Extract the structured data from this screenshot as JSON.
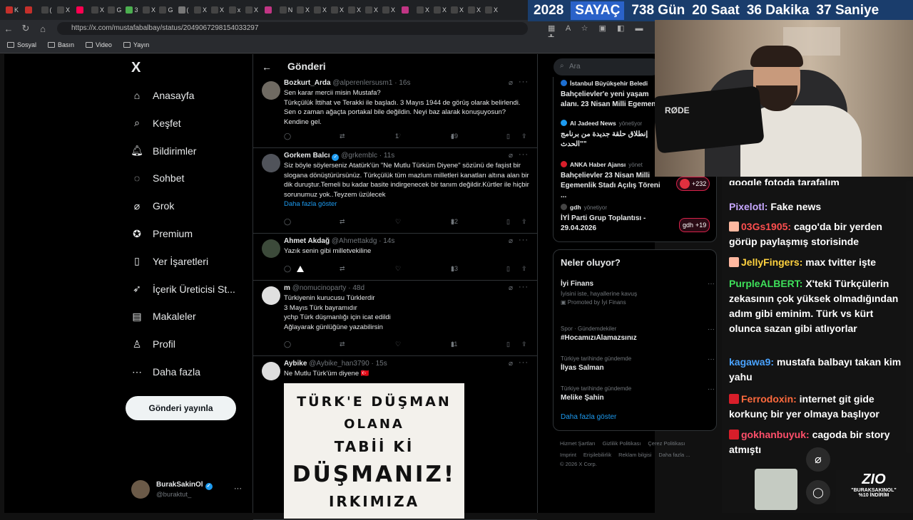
{
  "browser": {
    "url": "https://x.com/mustafabalbay/status/2049067298154033297",
    "bookmarks": [
      "Sosyal",
      "Basın",
      "Video",
      "Yayın"
    ],
    "tab_glyphs": [
      "K",
      "",
      "(",
      "X",
      "",
      "X",
      "G",
      "3",
      "X",
      "G",
      "(",
      "X",
      "X",
      "x",
      "X",
      "",
      "N",
      "X",
      "X",
      "X",
      "X",
      "X",
      "X",
      "",
      "X",
      "X",
      "X",
      "X",
      "X"
    ]
  },
  "countdown": {
    "year": "2028",
    "label": "SAYAÇ",
    "days": "738 Gün",
    "hours": "20 Saat",
    "minutes": "36 Dakika",
    "seconds": "37 Saniye"
  },
  "sidebar": {
    "logo": "X",
    "items": [
      {
        "label": "Anasayfa",
        "icon": "home-icon"
      },
      {
        "label": "Keşfet",
        "icon": "search-icon"
      },
      {
        "label": "Bildirimler",
        "icon": "bell-icon"
      },
      {
        "label": "Sohbet",
        "icon": "chat-icon"
      },
      {
        "label": "Grok",
        "icon": "grok-icon"
      },
      {
        "label": "Premium",
        "icon": "verified-icon"
      },
      {
        "label": "Yer İşaretleri",
        "icon": "bookmark-icon"
      },
      {
        "label": "İçerik Üreticisi St...",
        "icon": "rocket-icon"
      },
      {
        "label": "Makaleler",
        "icon": "article-icon"
      },
      {
        "label": "Profil",
        "icon": "user-icon"
      },
      {
        "label": "Daha fazla",
        "icon": "more-circle-icon"
      }
    ],
    "post_button": "Gönderi yayınla",
    "account": {
      "name": "BurakSakinOl",
      "handle": "@buraktut_"
    }
  },
  "feed": {
    "title": "Gönderi",
    "tweets": [
      {
        "name": "Bozkurt_Arda",
        "handle": "@alperenlersusm1 · 16s",
        "text": "Sen karar mercii misin Mustafa?\nTürkçülük İttihat ve Terakki ile başladı. 3 Mayıs 1944 de görüş olarak belirlendi. Sen o zaman ağaçta portakal bile değildin. Neyi baz alarak konuşuyosun? Kendine gel.",
        "likes": "1",
        "views": "49"
      },
      {
        "name": "Gorkem Balcı",
        "handle": "@grkemblc · 11s",
        "text": "Siz böyle söylerseniz Atatürk'ün \"Ne Mutlu Türküm Diyene\" sözünü de faşist bir slogana dönüştürürsünüz. Türkçülük tüm mazlum milletleri kanatları altına alan bir dik duruştur.Temeli bu kadar basite indirgenecek bir tanım değildir.Kürtler ile hiçbir sorunumuz yok..Teyzem üzülecek",
        "more": "Daha fazla göster",
        "views": "32"
      },
      {
        "name": "Ahmet Akdağ",
        "handle": "@Ahmettakdg · 14s",
        "text": "Yazık senin gibi milletvekiline",
        "views": "13"
      },
      {
        "name": "m",
        "handle": "@nomucinoparty · 48d",
        "text": "Türkiyenin kurucusu Türklerdir\n3 Mayıs Türk bayramıdır\nychp Türk düşmanlığı için icat edildi\nAğlayarak günlüğüne yazabilirsin",
        "views": "11"
      },
      {
        "name": "Aybike",
        "handle": "@Aybike_han3790 · 15s",
        "text": "Ne Mutlu Türk'üm diyene 🇹🇷",
        "image_lines": [
          "TÜRK'E DÜŞMAN",
          "OLANA",
          "TABİİ Kİ",
          "DÜŞMANIZ!",
          "IRKIMIZA"
        ]
      }
    ]
  },
  "right": {
    "search_placeholder": "Ara",
    "news": [
      {
        "source": "İstanbul Büyükşehir Beledi",
        "text": "Bahçelievler'e yeni yaşam alanı. 23 Nisan Milli Egemen"
      },
      {
        "source": "Al Jadeed News",
        "meta": "yönetiyor",
        "text": "إنطلاق حلقة جديدة من برنامج \"الحدث\""
      },
      {
        "source": "ANKA Haber Ajansı",
        "meta": "yönet",
        "text": "Bahçelievler 23 Nisan Milli Egemenlik Stadı Açılış Töreni ..."
      },
      {
        "source": "gdh",
        "meta": "yönetiyor",
        "text": "İYİ Parti Grup Toplantısı - 29.04.2026"
      }
    ],
    "pill_1": "+232",
    "pill_2": "+19",
    "pill_2_prefix": "gdh",
    "trending_title": "Neler oluyor?",
    "trends": [
      {
        "title": "İyi Finans",
        "sub": "İyisini iste, hayallerine kavuş",
        "promo": "Promoted by İyi Finans"
      },
      {
        "meta": "Spor · Gündemdekiler",
        "title": "#HocamızıAlamazsınız"
      },
      {
        "meta": "Türkiye tarihinde gündemde",
        "title": "İlyas Salman"
      },
      {
        "meta": "Türkiye tarihinde gündemde",
        "title": "Melike Şahin"
      }
    ],
    "show_more": "Daha fazla göster",
    "footer_1": [
      "Hizmet Şartları",
      "Gizlilik Politikası",
      "Çerez Politikası"
    ],
    "footer_2": [
      "Imprint",
      "Erişilebilirlik",
      "Reklam bilgisi",
      "Daha fazla ..."
    ],
    "copyright": "© 2026 X Corp."
  },
  "webcam": {
    "mic_brand": "RØDE"
  },
  "chat": {
    "partial": "google fotoda tarafalım",
    "messages": [
      {
        "user": "Pixelotl:",
        "text": "Fake news",
        "color": "#c7a8ff"
      },
      {
        "user": "03Gs1905:",
        "text": "cago'da bir yerden görüp paylaşmış storisinde",
        "color": "#ff4f4f"
      },
      {
        "user": "JellyFingers:",
        "text": "max tvitter işte",
        "color": "#ffd23f"
      },
      {
        "user": "PurpleALBERT:",
        "text": "X'teki Türkçülerin zekasının çok yüksek olmadığından adım gibi eminim. Türk vs kürt olunca sazan gibi atlıyorlar",
        "color": "#3ee05a"
      },
      {
        "user": "kagawa9:",
        "text": "mustafa balbayı takan kim yahu",
        "color": "#4aa3ff"
      },
      {
        "user": "Ferrodoxin:",
        "text": "internet git gide korkunç bir yer olmaya başlıyor",
        "color": "#ff6a3d"
      },
      {
        "user": "gokhanbuyuk:",
        "text": "cagoda bir story atmıştı",
        "color": "#ff4f6a"
      }
    ],
    "promo_brand": "ZIO",
    "promo_code": "\"BURAKSAKINOL\"",
    "promo_discount": "%10 İNDİRİM"
  }
}
